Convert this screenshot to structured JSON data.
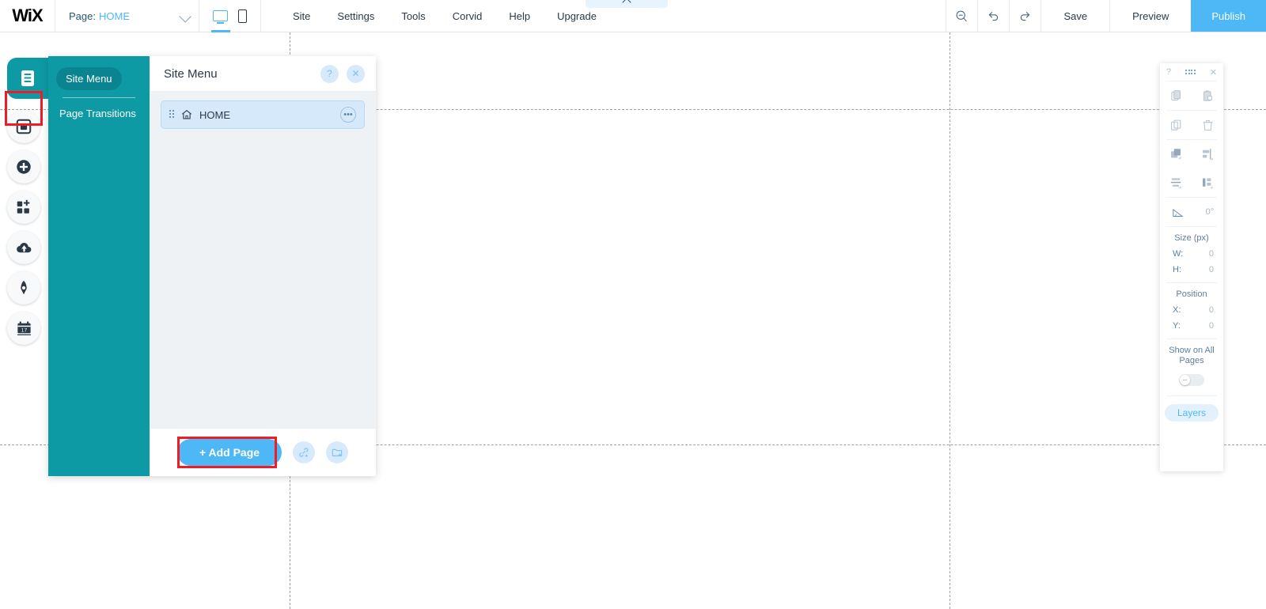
{
  "topbar": {
    "logo": "WiX",
    "page_label": "Page:",
    "page_value": "HOME",
    "chevron_icon": "chevron-down-icon",
    "devices": [
      {
        "name": "desktop-view-toggle",
        "icon": "desktop-icon",
        "active": true
      },
      {
        "name": "mobile-view-toggle",
        "icon": "mobile-icon",
        "active": false
      }
    ],
    "menu": [
      "Site",
      "Settings",
      "Tools",
      "Corvid",
      "Help",
      "Upgrade"
    ],
    "zoom_out_icon": "zoom-out-icon",
    "undo_icon": "undo-icon",
    "redo_icon": "redo-icon",
    "save": "Save",
    "preview": "Preview",
    "publish": "Publish",
    "publish_color": "#4eb7f5"
  },
  "collapse_tab": {
    "icon": "chevron-up-icon"
  },
  "rail": {
    "items": [
      {
        "name": "sidebar-item-pages",
        "icon": "pages-menu-icon",
        "active": true
      },
      {
        "name": "sidebar-item-background",
        "icon": "background-square-icon",
        "active": false
      },
      {
        "name": "sidebar-item-add",
        "icon": "plus-circle-icon",
        "active": false
      },
      {
        "name": "sidebar-item-app-market",
        "icon": "apps-grid-plus-icon",
        "active": false
      },
      {
        "name": "sidebar-item-media",
        "icon": "cloud-upload-icon",
        "active": false
      },
      {
        "name": "sidebar-item-blog",
        "icon": "pen-nib-icon",
        "active": false
      },
      {
        "name": "sidebar-item-bookings",
        "icon": "calendar-icon",
        "active": false
      }
    ],
    "highlight_color": "#ee1c25",
    "active_color": "#0d9aa4"
  },
  "panel": {
    "tabs": [
      {
        "label": "Site Menu",
        "active": true
      },
      {
        "label": "Page Transitions",
        "active": false
      }
    ],
    "title": "Site Menu",
    "help_icon": "question-mark-icon",
    "close_icon": "close-icon",
    "pages": [
      {
        "label": "HOME",
        "icon": "home-icon",
        "drag_icon": "drag-handle-icon",
        "more_icon": "more-options-icon",
        "selected": true
      }
    ],
    "footer": {
      "add_page_label": "+ Add Page",
      "add_page_color": "#4eb7f5",
      "add_link_icon": "add-link-icon",
      "add_folder_icon": "add-folder-icon",
      "highlight_color": "#ee1c25"
    },
    "sidebar_color": "#0d9aa4"
  },
  "props": {
    "help_icon": "question-mark-icon",
    "grip_icon": "drag-grip-icon",
    "close_icon": "close-icon",
    "tools": [
      {
        "name": "copy-button",
        "icon": "copy-icon"
      },
      {
        "name": "paste-button",
        "icon": "paste-icon"
      },
      {
        "name": "duplicate-button",
        "icon": "duplicate-icon"
      },
      {
        "name": "delete-button",
        "icon": "trash-icon"
      },
      {
        "name": "arrange-button",
        "icon": "arrange-layers-icon"
      },
      {
        "name": "align-button",
        "icon": "align-icon"
      },
      {
        "name": "distribute-button",
        "icon": "distribute-icon"
      },
      {
        "name": "match-size-button",
        "icon": "match-size-icon"
      }
    ],
    "rotation": {
      "icon": "rotate-angle-icon",
      "value": "0°"
    },
    "size": {
      "title": "Size (px)",
      "w_label": "W:",
      "w_value": "0",
      "h_label": "H:",
      "h_value": "0"
    },
    "position": {
      "title": "Position",
      "x_label": "X:",
      "x_value": "0",
      "y_label": "Y:",
      "y_value": "0"
    },
    "show_all": {
      "label": "Show on All Pages",
      "enabled": false
    },
    "layers_label": "Layers"
  }
}
